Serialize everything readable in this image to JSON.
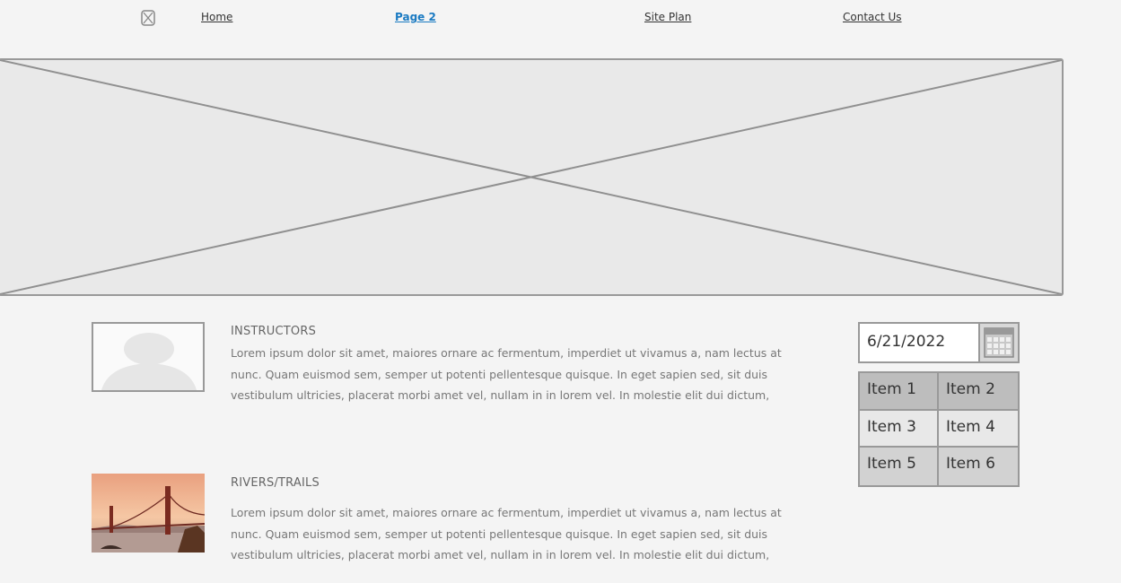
{
  "nav": {
    "logo_icon": "broken-image-icon",
    "links": [
      {
        "label": "Home",
        "active": false
      },
      {
        "label": "Page 2",
        "active": true
      },
      {
        "label": "Site Plan",
        "active": false
      },
      {
        "label": "Contact Us",
        "active": false
      }
    ]
  },
  "hero": {
    "icon": "image-placeholder-icon"
  },
  "sections": [
    {
      "title": "INSTRUCTORS",
      "body": "Lorem ipsum dolor sit amet, maiores ornare ac fermentum, imperdiet ut vivamus a, nam lectus at nunc. Quam euismod sem, semper ut potenti pellentesque quisque. In eget sapien sed, sit duis vestibulum ultricies, placerat morbi amet vel, nullam in in lorem vel. In molestie elit dui dictum,",
      "image": "avatar-placeholder-icon"
    },
    {
      "title": "RIVERS/TRAILS",
      "body": "Lorem ipsum dolor sit amet, maiores ornare ac fermentum, imperdiet ut vivamus a, nam lectus at nunc. Quam euismod sem, semper ut potenti pellentesque quisque. In eget sapien sed, sit duis vestibulum ultricies, placerat morbi amet vel, nullam in in lorem vel. In molestie elit dui dictum,",
      "image": "bridge-photo"
    }
  ],
  "datepicker": {
    "value": "6/21/2022",
    "icon": "calendar-icon"
  },
  "item_grid": {
    "items": [
      "Item 1",
      "Item 2",
      "Item 3",
      "Item 4",
      "Item 5",
      "Item 6"
    ]
  },
  "colors": {
    "background": "#f4f4f4",
    "active_link": "#1a7ac2",
    "border": "#999999"
  }
}
